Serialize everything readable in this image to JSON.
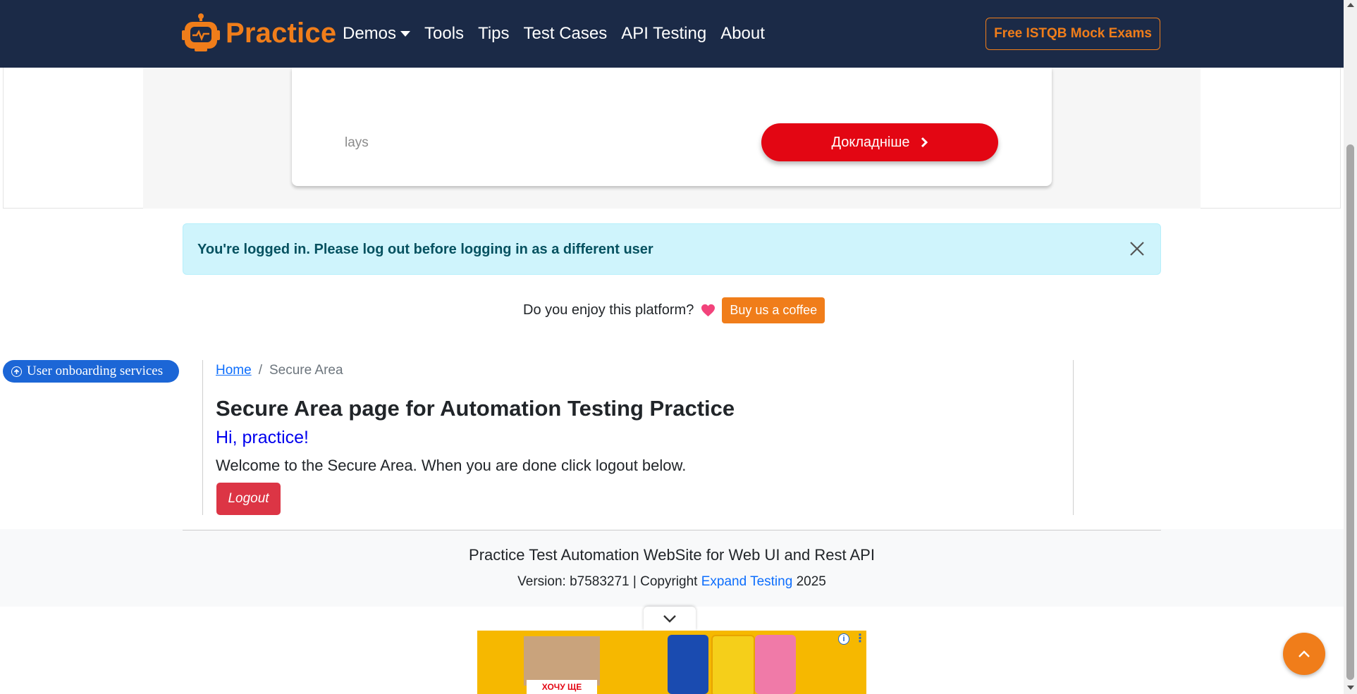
{
  "navbar": {
    "brand": "Practice",
    "links": [
      "Demos",
      "Tools",
      "Tips",
      "Test Cases",
      "API Testing",
      "About"
    ],
    "cta": "Free ISTQB Mock Exams"
  },
  "top_ad": {
    "brand": "lays",
    "cta": "Докладніше"
  },
  "alert": {
    "message": "You're logged in. Please log out before logging in as a different user"
  },
  "coffee": {
    "question": "Do you enjoy this platform?",
    "button": "Buy us a coffee"
  },
  "onboarding": {
    "label": "User onboarding services"
  },
  "breadcrumb": {
    "home": "Home",
    "separator": "/",
    "current": "Secure Area"
  },
  "main": {
    "title": "Secure Area page for Automation Testing Practice",
    "greeting": "Hi, practice!",
    "welcome": "Welcome to the Secure Area. When you are done click logout below.",
    "logout": "Logout"
  },
  "footer": {
    "title": "Practice Test Automation WebSite for Web UI and Rest API",
    "version_prefix": "Version: b7583271 | Copyright",
    "company": "Expand Testing",
    "year": "2025"
  },
  "bottom_ad": {
    "photo_caption": "ХОЧУ ЩЕ"
  },
  "colors": {
    "navbar_bg": "#1b2a47",
    "brand_orange": "#f07d1a",
    "alert_bg": "#cff4fc",
    "logout_red": "#dc3545",
    "ad_red": "#e30613"
  },
  "icons": [
    "robot-logo-icon",
    "caret-down-icon",
    "close-icon",
    "heart-icon",
    "arrow-circle-up-icon",
    "chevron-right-icon",
    "chevron-down-icon",
    "chevron-up-icon",
    "info-icon",
    "more-dots-icon"
  ]
}
